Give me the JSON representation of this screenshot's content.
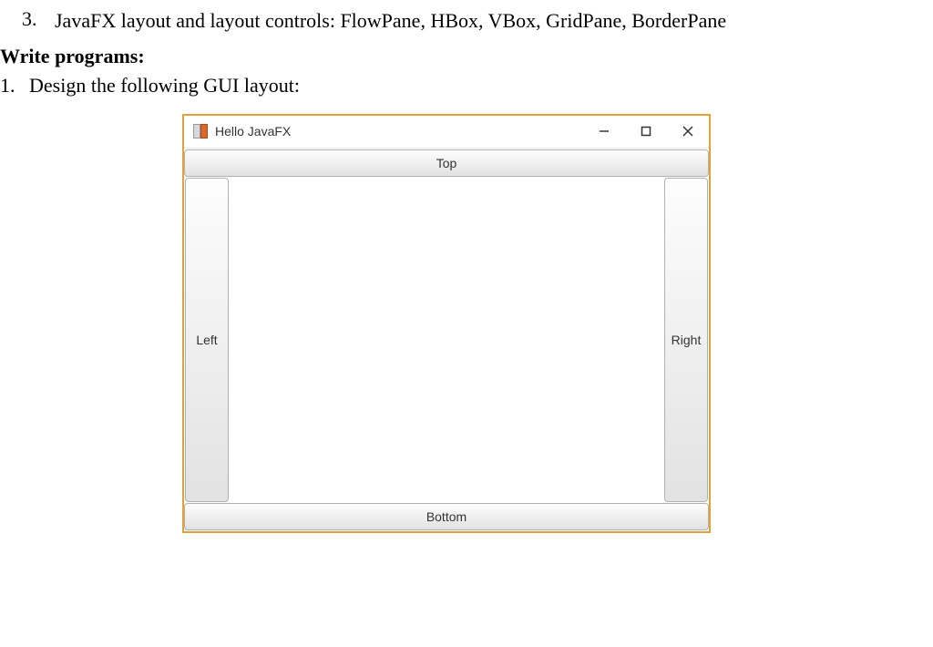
{
  "doc": {
    "item3_num": "3.",
    "item3_text": "JavaFX layout and layout controls: FlowPane, HBox, VBox, GridPane, BorderPane",
    "write_heading": "Write programs:",
    "item1_num": "1.",
    "item1_text": "Design the following GUI layout:"
  },
  "window": {
    "title": "Hello JavaFX",
    "buttons": {
      "top": "Top",
      "bottom": "Bottom",
      "left": "Left",
      "right": "Right"
    }
  }
}
